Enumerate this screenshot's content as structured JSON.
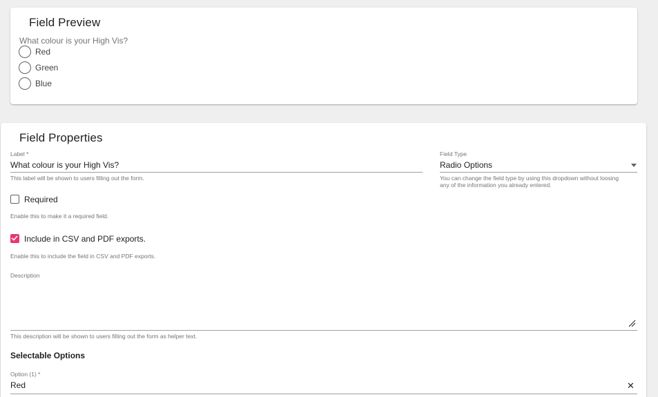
{
  "preview": {
    "title": "Field Preview",
    "question": "What colour is your High Vis?",
    "options": [
      "Red",
      "Green",
      "Blue"
    ]
  },
  "properties": {
    "title": "Field Properties",
    "label_field": {
      "label": "Label *",
      "value": "What colour is your High Vis?",
      "helper": "This label will be shown to users filling out the form."
    },
    "field_type": {
      "label": "Field Type",
      "value": "Radio Options",
      "helper_line1": "You can change the field type by using this dropdown without loosing",
      "helper_line2": "any of the information you already entered."
    },
    "required": {
      "label": "Required",
      "checked": false,
      "helper": "Enable this to make it a required field."
    },
    "include_exports": {
      "label": "Include in CSV and PDF exports.",
      "checked": true,
      "helper": "Enable this to include the field in CSV and PDF exports."
    },
    "description": {
      "label": "Description",
      "value": "",
      "helper": "This description will be shown to users filling out the form as helper text."
    },
    "selectable_options": {
      "heading": "Selectable Options",
      "option1": {
        "label": "Option (1) *",
        "value": "Red"
      }
    }
  },
  "colors": {
    "accent": "#e8386d",
    "background": "#efefef",
    "card": "#ffffff"
  },
  "icons": {
    "checkmark": "check-icon",
    "dropdown": "chevron-down-icon",
    "resize": "resize-handle-icon",
    "clear": "close-icon"
  }
}
